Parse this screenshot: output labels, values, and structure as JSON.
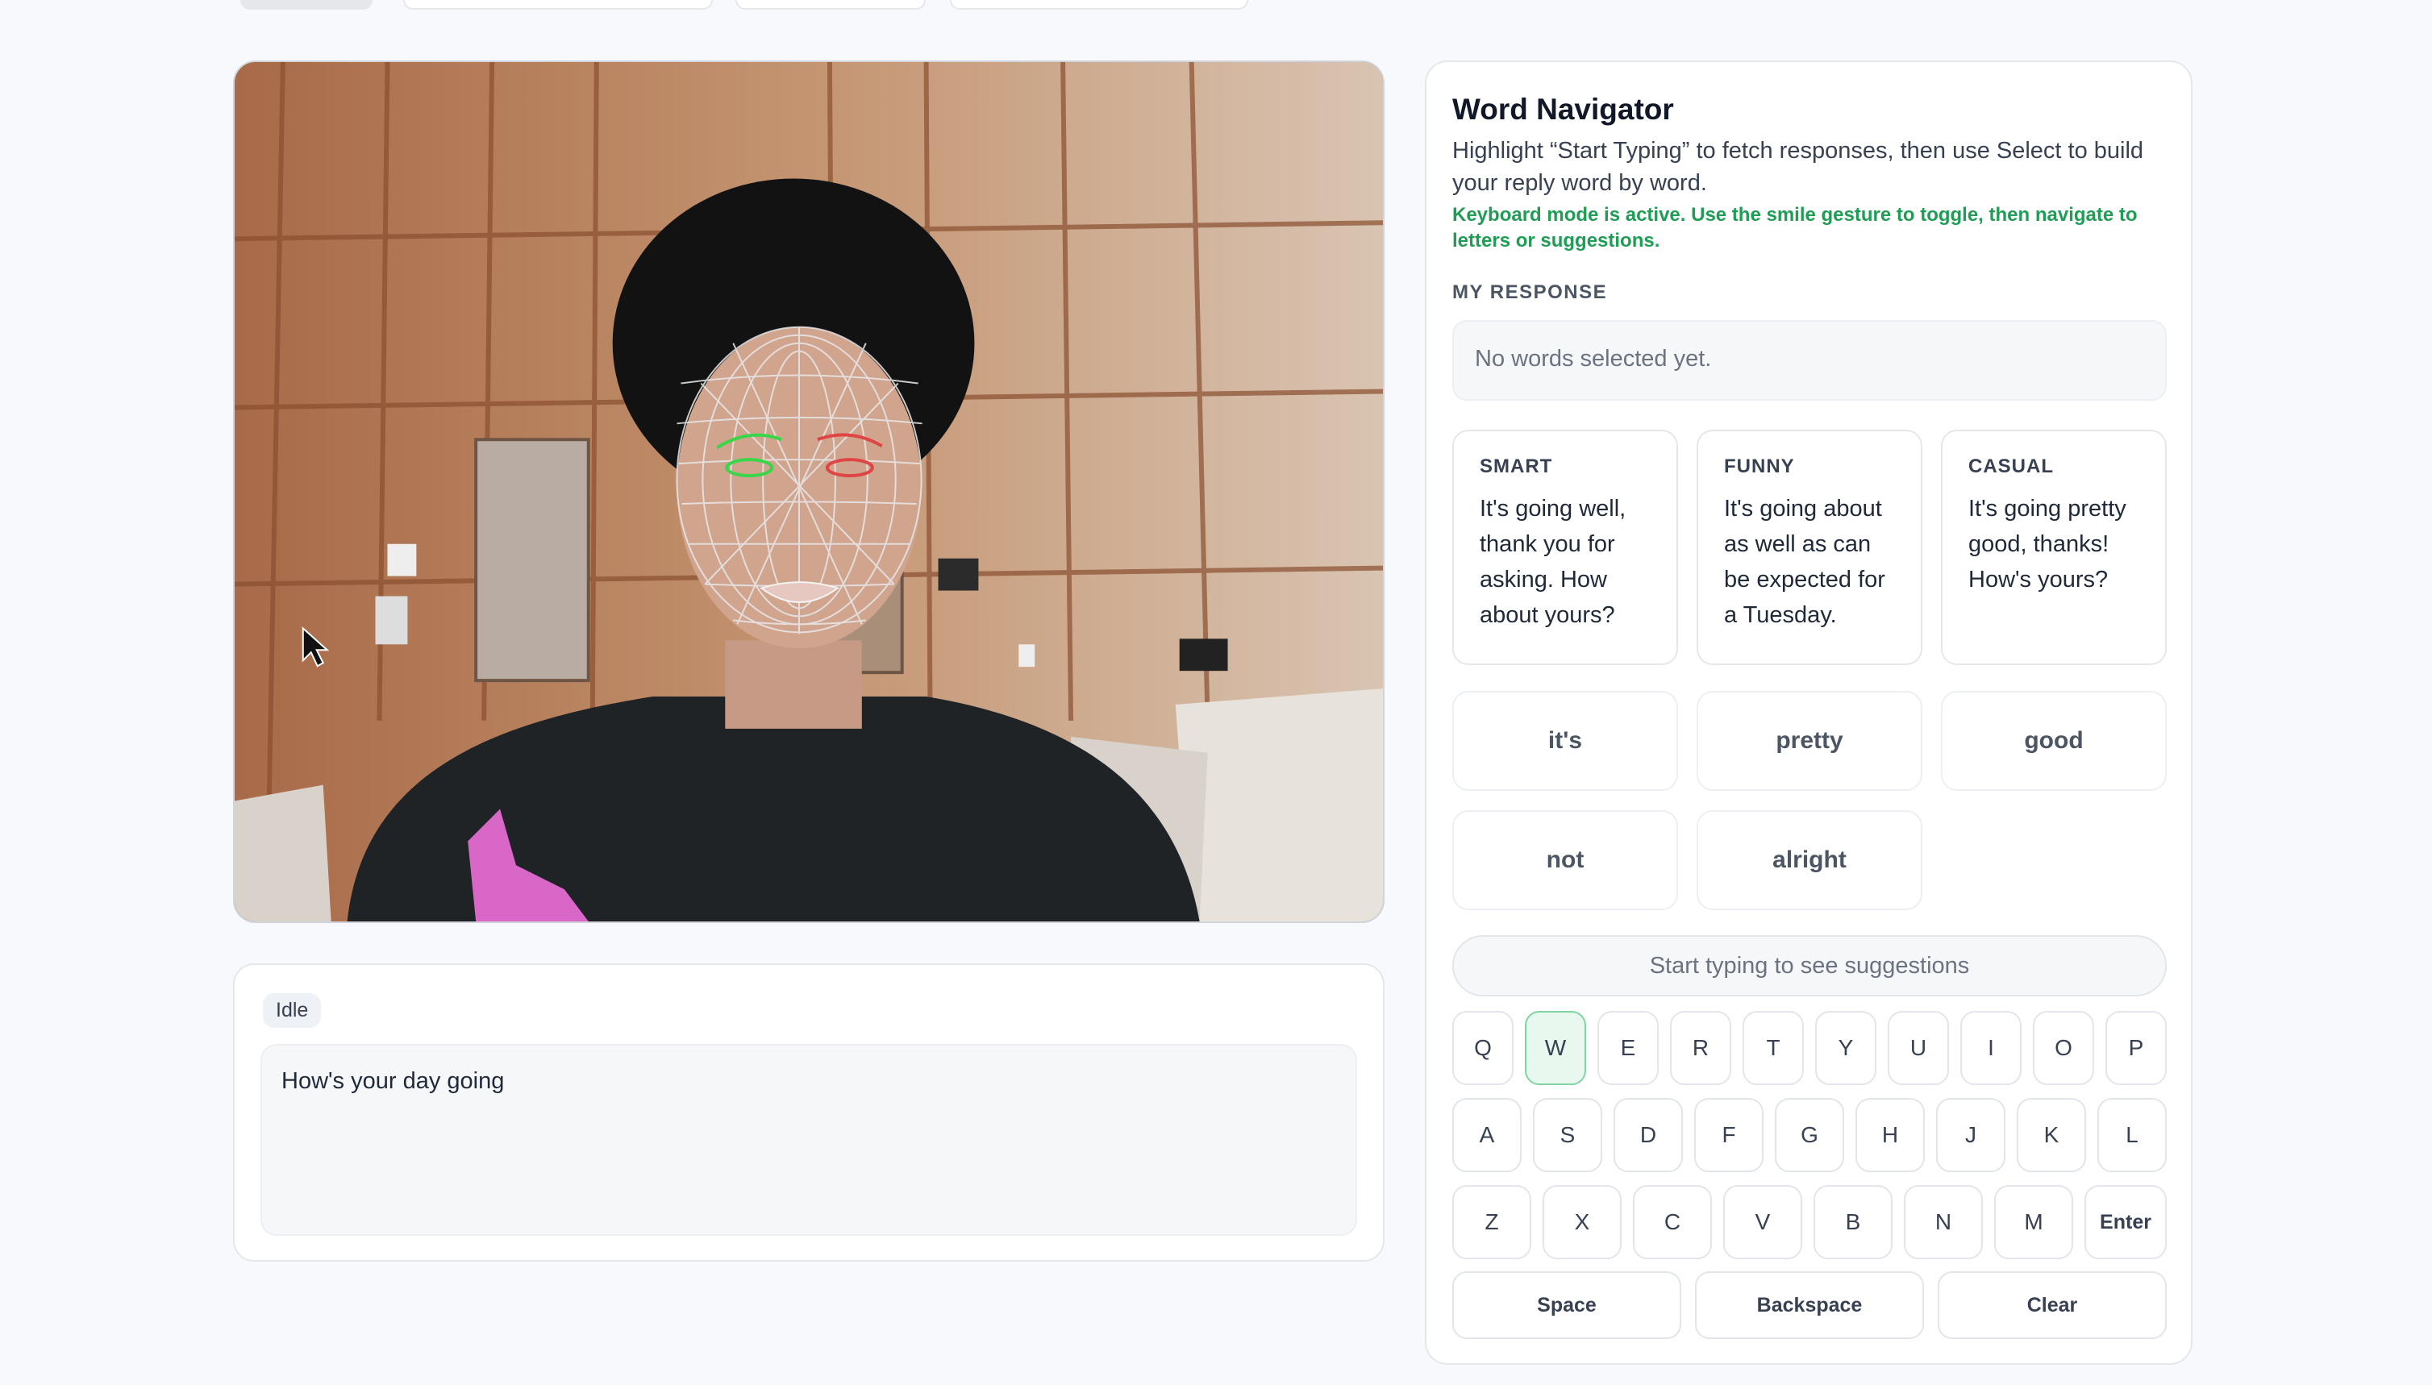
{
  "navigator": {
    "title": "Word Navigator",
    "description": "Highlight “Start Typing” to fetch responses, then use Select to build your reply word by word.",
    "mode_message": "Keyboard mode is active. Use the smile gesture to toggle, then navigate to letters or suggestions.",
    "response_label": "MY RESPONSE",
    "response_placeholder": "No words selected yet.",
    "suggestions": [
      {
        "tag": "SMART",
        "text": "It's going well, thank you for asking. How about yours?"
      },
      {
        "tag": "FUNNY",
        "text": "It's going about as well as can be expected for a Tuesday."
      },
      {
        "tag": "CASUAL",
        "text": "It's going pretty good, thanks! How's yours?"
      }
    ],
    "words": [
      "it's",
      "pretty",
      "good",
      "not",
      "alright"
    ],
    "typing_prompt": "Start typing to see suggestions"
  },
  "keyboard": {
    "row1": [
      "Q",
      "W",
      "E",
      "R",
      "T",
      "Y",
      "U",
      "I",
      "O",
      "P"
    ],
    "row2": [
      "A",
      "S",
      "D",
      "F",
      "G",
      "H",
      "J",
      "K",
      "L"
    ],
    "row3": [
      "Z",
      "X",
      "C",
      "V",
      "B",
      "N",
      "M",
      "Enter"
    ],
    "active_key": "W",
    "space": "Space",
    "backspace": "Backspace",
    "clear": "Clear"
  },
  "transcript": {
    "status": "Idle",
    "text": "How's your day going"
  },
  "colors": {
    "accent_green": "#1f9d55",
    "active_key_bg": "#e9f8ef"
  }
}
